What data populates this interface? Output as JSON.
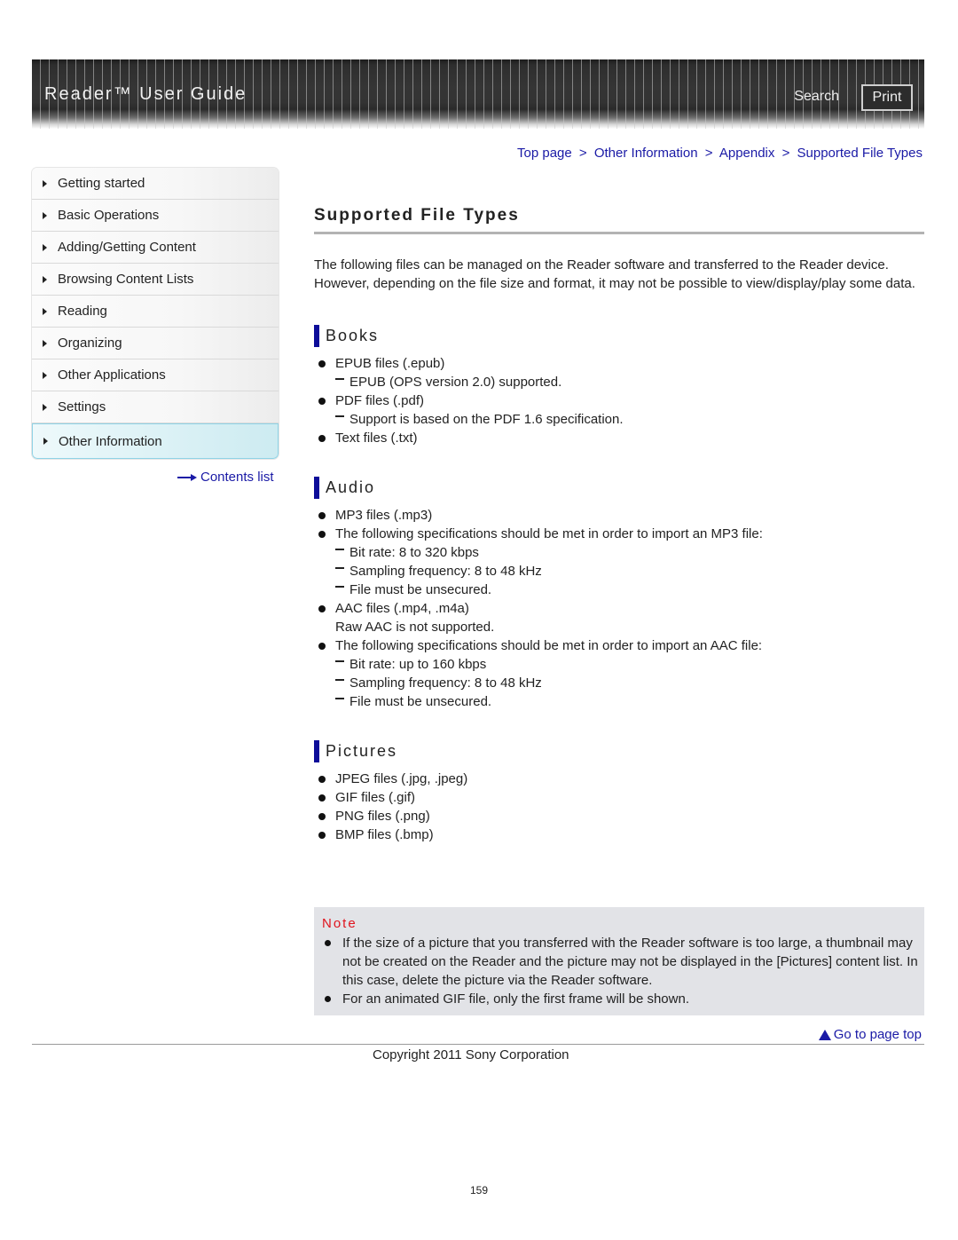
{
  "header": {
    "title": "Reader™ User Guide",
    "search_label": "Search",
    "print_label": "Print"
  },
  "breadcrumb": {
    "items": [
      "Top page",
      "Other Information",
      "Appendix",
      "Supported File Types"
    ],
    "separator": ">"
  },
  "sidebar": {
    "items": [
      {
        "label": "Getting started"
      },
      {
        "label": "Basic Operations"
      },
      {
        "label": "Adding/Getting Content"
      },
      {
        "label": "Browsing Content Lists"
      },
      {
        "label": "Reading"
      },
      {
        "label": "Organizing"
      },
      {
        "label": "Other Applications"
      },
      {
        "label": "Settings"
      },
      {
        "label": "Other Information",
        "active": true
      }
    ],
    "contents_list_label": "Contents list"
  },
  "main": {
    "title": "Supported File Types",
    "intro": [
      "The following files can be managed on the Reader software and transferred to the Reader device.",
      "However, depending on the file size and format, it may not be possible to view/display/play some data."
    ],
    "sections": {
      "books": {
        "heading": "Books",
        "items": [
          {
            "type": "bullet",
            "text": "EPUB files (.epub)"
          },
          {
            "type": "sub",
            "text": "EPUB (OPS version 2.0) supported."
          },
          {
            "type": "bullet",
            "text": "PDF files (.pdf)"
          },
          {
            "type": "sub",
            "text": "Support is based on the PDF 1.6 specification."
          },
          {
            "type": "bullet",
            "text": "Text files (.txt)"
          }
        ]
      },
      "audio": {
        "heading": "Audio",
        "items": [
          {
            "type": "bullet",
            "text": "MP3 files (.mp3)"
          },
          {
            "type": "bullet",
            "text": "The following specifications should be met in order to import an MP3 file:"
          },
          {
            "type": "sub",
            "text": "Bit rate: 8 to 320 kbps"
          },
          {
            "type": "sub",
            "text": "Sampling frequency: 8 to 48 kHz"
          },
          {
            "type": "sub",
            "text": "File must be unsecured."
          },
          {
            "type": "bullet",
            "text": "AAC files (.mp4, .m4a)"
          },
          {
            "type": "plain",
            "text": "Raw AAC is not supported."
          },
          {
            "type": "bullet",
            "text": "The following specifications should be met in order to import an AAC file:"
          },
          {
            "type": "sub",
            "text": "Bit rate: up to 160 kbps"
          },
          {
            "type": "sub",
            "text": "Sampling frequency: 8 to 48 kHz"
          },
          {
            "type": "sub",
            "text": "File must be unsecured."
          }
        ]
      },
      "pictures": {
        "heading": "Pictures",
        "items": [
          {
            "type": "bullet",
            "text": "JPEG files (.jpg, .jpeg)"
          },
          {
            "type": "bullet",
            "text": "GIF files (.gif)"
          },
          {
            "type": "bullet",
            "text": "PNG files (.png)"
          },
          {
            "type": "bullet",
            "text": "BMP files (.bmp)"
          }
        ]
      }
    },
    "note": {
      "title": "Note",
      "items": [
        "If the size of a picture that you transferred with the Reader software is too large, a thumbnail may not be created on the Reader and the picture may not be displayed in the [Pictures] content list. In this case, delete the picture via the Reader software.",
        "For an animated GIF file, only the first frame will be shown."
      ]
    }
  },
  "footer": {
    "go_to_top_label": "Go to page top",
    "copyright": "Copyright 2011 Sony Corporation",
    "page_number": "159"
  },
  "colors": {
    "link": "#1a1aa6",
    "section_bar": "#0d0d99",
    "note_title": "#e0141e",
    "note_background": "#e2e3e7"
  }
}
